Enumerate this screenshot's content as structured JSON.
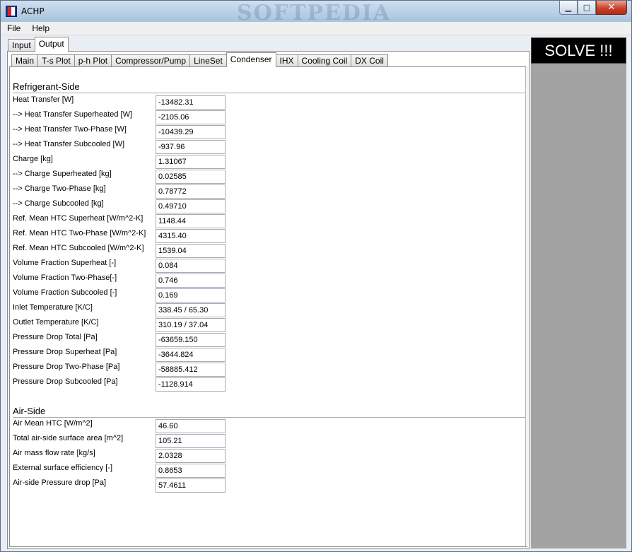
{
  "window": {
    "title": "ACHP",
    "watermark": "SOFTPEDIA"
  },
  "menu": [
    "File",
    "Help"
  ],
  "outer_tabs": [
    "Input",
    "Output"
  ],
  "outer_active": "Output",
  "inner_tabs": [
    "Main",
    "T-s Plot",
    "p-h Plot",
    "Compressor/Pump",
    "LineSet",
    "Condenser",
    "IHX",
    "Cooling Coil",
    "DX Coil"
  ],
  "inner_active": "Condenser",
  "solve_label": "SOLVE !!!",
  "refrigerant": {
    "title": "Refrigerant-Side",
    "rows": [
      {
        "label": "Heat Transfer [W]",
        "value": "-13482.31"
      },
      {
        "label": "--> Heat Transfer Superheated [W]",
        "value": "-2105.06"
      },
      {
        "label": "--> Heat Transfer Two-Phase [W]",
        "value": "-10439.29"
      },
      {
        "label": "--> Heat Transfer Subcooled [W]",
        "value": "-937.96"
      },
      {
        "label": "Charge [kg]",
        "value": "1.31067"
      },
      {
        "label": "--> Charge Superheated [kg]",
        "value": "0.02585"
      },
      {
        "label": "--> Charge Two-Phase [kg]",
        "value": "0.78772"
      },
      {
        "label": "--> Charge Subcooled [kg]",
        "value": "0.49710"
      },
      {
        "label": "Ref. Mean HTC Superheat [W/m^2-K]",
        "value": "1148.44"
      },
      {
        "label": "Ref. Mean HTC Two-Phase [W/m^2-K]",
        "value": "4315.40"
      },
      {
        "label": "Ref. Mean HTC Subcooled [W/m^2-K]",
        "value": "1539.04"
      },
      {
        "label": "Volume Fraction Superheat [-]",
        "value": "0.084"
      },
      {
        "label": "Volume Fraction Two-Phase[-]",
        "value": "0.746"
      },
      {
        "label": "Volume Fraction Subcooled [-]",
        "value": "0.169"
      },
      {
        "label": "Inlet Temperature [K/C]",
        "value": "338.45 / 65.30"
      },
      {
        "label": "Outlet Temperature [K/C]",
        "value": "310.19 / 37.04"
      },
      {
        "label": "Pressure Drop Total [Pa]",
        "value": "-63659.150"
      },
      {
        "label": "Pressure Drop Superheat [Pa]",
        "value": "-3644.824"
      },
      {
        "label": "Pressure Drop Two-Phase [Pa]",
        "value": "-58885.412"
      },
      {
        "label": "Pressure Drop Subcooled [Pa]",
        "value": "-1128.914"
      }
    ]
  },
  "air": {
    "title": "Air-Side",
    "rows": [
      {
        "label": "Air Mean HTC [W/m^2]",
        "value": "46.60"
      },
      {
        "label": "Total air-side surface area [m^2]",
        "value": "105.21"
      },
      {
        "label": "Air mass flow rate [kg/s]",
        "value": "2.0328"
      },
      {
        "label": "External surface efficiency [-]",
        "value": "0.8653"
      },
      {
        "label": "Air-side Pressure drop [Pa]",
        "value": "57.4611"
      }
    ]
  }
}
